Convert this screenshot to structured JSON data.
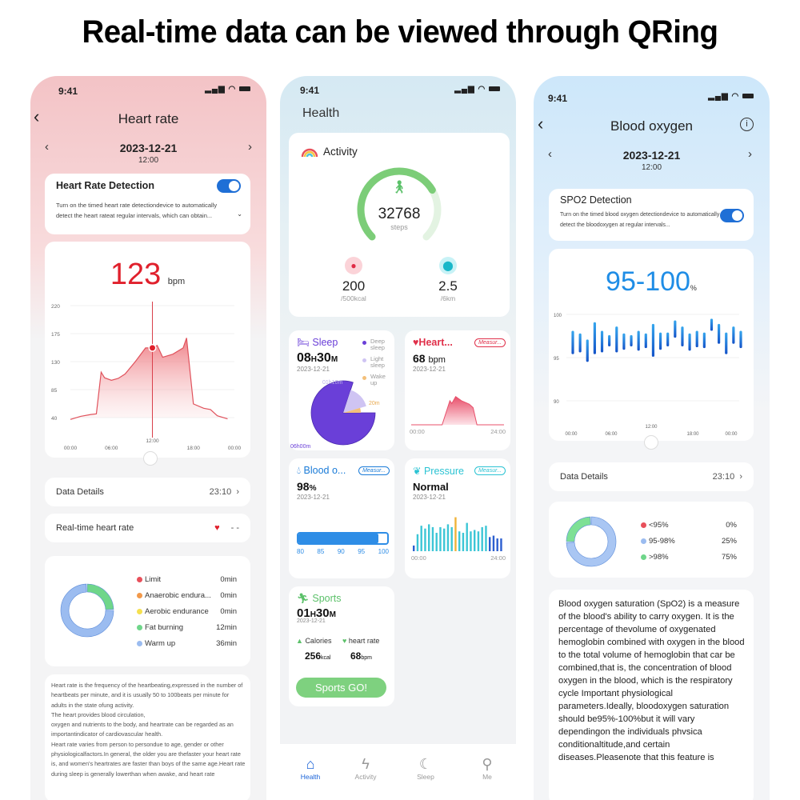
{
  "headline": "Real-time data can be viewed through QRing",
  "status_bar": {
    "time": "9:41"
  },
  "heart_rate_screen": {
    "title": "Heart rate",
    "date": "2023-12-21",
    "time": "12:00",
    "detection": {
      "title": "Heart Rate Detection",
      "enabled": true,
      "description": "Turn on the timed heart rate detectiondevice to automatically detect the heart rateat regular intervals, which can obtain..."
    },
    "current_value": "123",
    "unit": "bpm",
    "data_details": {
      "label": "Data Details",
      "value": "23:10"
    },
    "realtime": {
      "label": "Real-time heart rate",
      "value": "- -"
    },
    "zones": [
      {
        "label": "Limit",
        "value": "0min",
        "color": "#e8505b"
      },
      {
        "label": "Anaerobic endura...",
        "value": "0min",
        "color": "#f2994a"
      },
      {
        "label": "Aerobic endurance",
        "value": "0min",
        "color": "#f5e050"
      },
      {
        "label": "Fat burning",
        "value": "12min",
        "color": "#6fd68a"
      },
      {
        "label": "Warm up",
        "value": "36min",
        "color": "#9bbcf0"
      }
    ],
    "description": "Heart rate is the frequency of the heartbeating,expressed in the number of heartbeats per minute, and it is usually 50 to 100beats per minute for adults in the state ofung activity.\nThe heart provides blood circulation,\noxygen and nutrients to the body, and heartrate can be regarded as an importantindicator of cardiovascular health.\nHeart rate varies from person to persondue to age, gender or other physiologicalfactors.In general, the older you are thefaster your heart rate is, and women's heartrates are faster than boys of the same age.Heart rate during sleep is generally lowerthan when awake, and heart rate duringexercise varies with exercise intensity.Please note that this feature"
  },
  "health_screen": {
    "title": "Health",
    "activity": {
      "title": "Activity",
      "steps": "32768",
      "steps_label": "steps",
      "steps_progress": 0.72,
      "calories": "200",
      "calories_goal": "/500kcal",
      "distance": "2.5",
      "distance_goal": "/6km"
    },
    "sleep": {
      "title": "Sleep",
      "duration_h": "08",
      "duration_m": "30",
      "h_unit": "H",
      "m_unit": "M",
      "date": "2023-12-21",
      "legend": [
        {
          "label": "Deep sleep",
          "color": "#6a3fd8"
        },
        {
          "label": "Light sleep",
          "color": "#cfc4f3"
        },
        {
          "label": "Wake up",
          "color": "#f3c07a"
        }
      ],
      "labels": {
        "deep": "06h00m",
        "light": "01h10m",
        "wake": "20m"
      }
    },
    "heart": {
      "title": "Heart...",
      "measure": "Measur...",
      "value": "68",
      "unit": "bpm",
      "date": "2023-12-21",
      "x_start": "00:00",
      "x_end": "24:00"
    },
    "blood_oxygen": {
      "title": "Blood o...",
      "measure": "Measur...",
      "value": "98",
      "unit": "%",
      "date": "2023-12-21",
      "scale": [
        "80",
        "85",
        "90",
        "95",
        "100"
      ],
      "fill_fraction": 0.9
    },
    "pressure": {
      "title": "Pressure",
      "measure": "Measur...",
      "value": "Normal",
      "date": "2023-12-21",
      "x_start": "00:00",
      "x_end": "24:00"
    },
    "sports": {
      "title": "Sports",
      "duration_h": "01",
      "duration_m": "30",
      "h_unit": "H",
      "m_unit": "M",
      "date": "2023-12-21",
      "calories_label": "Calories",
      "calories": "256",
      "calories_unit": "kcal",
      "hr_label": "heart rate",
      "hr": "68",
      "hr_unit": "bpm",
      "button": "Sports GO!"
    },
    "tabs": [
      {
        "label": "Health",
        "icon": "home-icon",
        "active": true
      },
      {
        "label": "Activity",
        "icon": "lightning-icon",
        "active": false
      },
      {
        "label": "Sleep",
        "icon": "moon-icon",
        "active": false
      },
      {
        "label": "Me",
        "icon": "person-icon",
        "active": false
      }
    ]
  },
  "blood_oxygen_screen": {
    "title": "Blood oxygen",
    "date": "2023-12-21",
    "time": "12:00",
    "detection": {
      "title": "SPO2 Detection",
      "enabled": true,
      "description": "Turn on the timed blood oxygen detectiondevice to automatically detect the bloodoxygen at regular intervals..."
    },
    "current_value": "95-100",
    "unit": "%",
    "data_details": {
      "label": "Data Details",
      "value": "23:10"
    },
    "distribution": [
      {
        "label": "<95%",
        "value": "0%",
        "color": "#e8505b"
      },
      {
        "label": "95-98%",
        "value": "25%",
        "color": "#9bbcf0"
      },
      {
        "label": ">98%",
        "value": "75%",
        "color": "#6fd68a"
      }
    ],
    "description": "Blood oxygen saturation (SpO2) is a measure of the blood's ability to carry oxygen. It is the percentage of thevolume of oxygenated hemoglobin combined with oxygen in the blood to the total volume of hemoglobin that car be combined,that is, the concentration of blood oxygen in the blood, which is the respiratory cycle Important physiological parameters.Ideally, bloodoxygen saturation should be95%-100%but it will vary dependingon the individuals phvsica conditionaltitude,and certain diseases.Pleasenote that this feature is"
  },
  "chart_data": [
    {
      "id": "heart-rate-day",
      "type": "area",
      "title": "Heart rate",
      "x_ticks": [
        "00:00",
        "06:00",
        "12:00",
        "18:00",
        "00:00"
      ],
      "y_ticks": [
        40,
        85,
        130,
        175,
        220
      ],
      "ylim": [
        40,
        220
      ],
      "xlim": [
        0,
        24
      ],
      "x": [
        0,
        1.5,
        3,
        3.8,
        4.5,
        5,
        6,
        7,
        8,
        9.5,
        11,
        12,
        12.7,
        13.5,
        15,
        16.5,
        17,
        18,
        19.5,
        20.5,
        21.5,
        23
      ],
      "values": [
        37,
        42,
        45,
        46,
        113,
        104,
        100,
        103,
        110,
        130,
        152,
        152,
        156,
        137,
        142,
        152,
        168,
        62,
        55,
        53,
        43,
        38
      ],
      "highlight": {
        "x": 12,
        "value": 152
      },
      "grid": true
    },
    {
      "id": "heart-mini",
      "type": "area",
      "x": [
        0,
        8,
        10,
        10.5,
        11.5,
        13,
        15,
        16,
        17,
        24
      ],
      "values": [
        0,
        0,
        70,
        62,
        82,
        70,
        60,
        50,
        0,
        0
      ],
      "xlim": [
        0,
        24
      ],
      "ylim": [
        0,
        100
      ]
    },
    {
      "id": "sleep-pie",
      "type": "pie",
      "categories": [
        "Deep sleep",
        "Light sleep",
        "Wake up"
      ],
      "values": [
        360,
        70,
        20
      ],
      "unit": "min"
    },
    {
      "id": "pressure-bars",
      "type": "bar",
      "values": [
        2,
        6,
        9,
        8,
        9.5,
        8.5,
        6.5,
        8.5,
        8,
        9.5,
        8.5,
        12,
        7,
        6.5,
        10,
        7,
        7.5,
        7,
        8.5,
        9,
        5,
        5.5,
        4.5,
        4.5
      ],
      "highlight_index": 11,
      "dark_indices": [
        0,
        20,
        21,
        22,
        23
      ],
      "ylim": [
        0,
        13
      ]
    },
    {
      "id": "spo2-range",
      "type": "bar",
      "title": "Blood oxygen",
      "y_ticks": [
        90,
        95,
        100
      ],
      "ylim": [
        88,
        100
      ],
      "x_ticks": [
        "00:00",
        "06:00",
        "12:00",
        "18:00",
        "00:00"
      ],
      "ranges": [
        [
          95.4,
          98.1
        ],
        [
          95.6,
          97.8
        ],
        [
          94.5,
          97.1
        ],
        [
          95.4,
          99.1
        ],
        [
          95.6,
          98.1
        ],
        [
          96.3,
          97.6
        ],
        [
          95.6,
          98.6
        ],
        [
          95.9,
          97.8
        ],
        [
          96.3,
          97.6
        ],
        [
          95.8,
          98.1
        ],
        [
          96.1,
          97.8
        ],
        [
          95.1,
          98.9
        ],
        [
          95.9,
          97.9
        ],
        [
          96.3,
          97.9
        ],
        [
          97.3,
          99.3
        ],
        [
          96.3,
          98.6
        ],
        [
          95.8,
          97.8
        ],
        [
          96.2,
          98.1
        ],
        [
          96.1,
          97.9
        ],
        [
          98.1,
          99.5
        ],
        [
          96.6,
          98.9
        ],
        [
          95.4,
          97.9
        ],
        [
          96.6,
          98.6
        ],
        [
          96.1,
          98.1
        ]
      ]
    },
    {
      "id": "hr-zone-donut",
      "type": "pie",
      "categories": [
        "Limit",
        "Anaerobic endurance",
        "Aerobic endurance",
        "Fat burning",
        "Warm up"
      ],
      "values": [
        0,
        0,
        0,
        12,
        36
      ],
      "unit": "min"
    },
    {
      "id": "spo2-donut",
      "type": "pie",
      "categories": [
        "<95%",
        "95-98%",
        ">98%"
      ],
      "values": [
        0,
        75,
        25
      ],
      "unit": "%"
    }
  ]
}
